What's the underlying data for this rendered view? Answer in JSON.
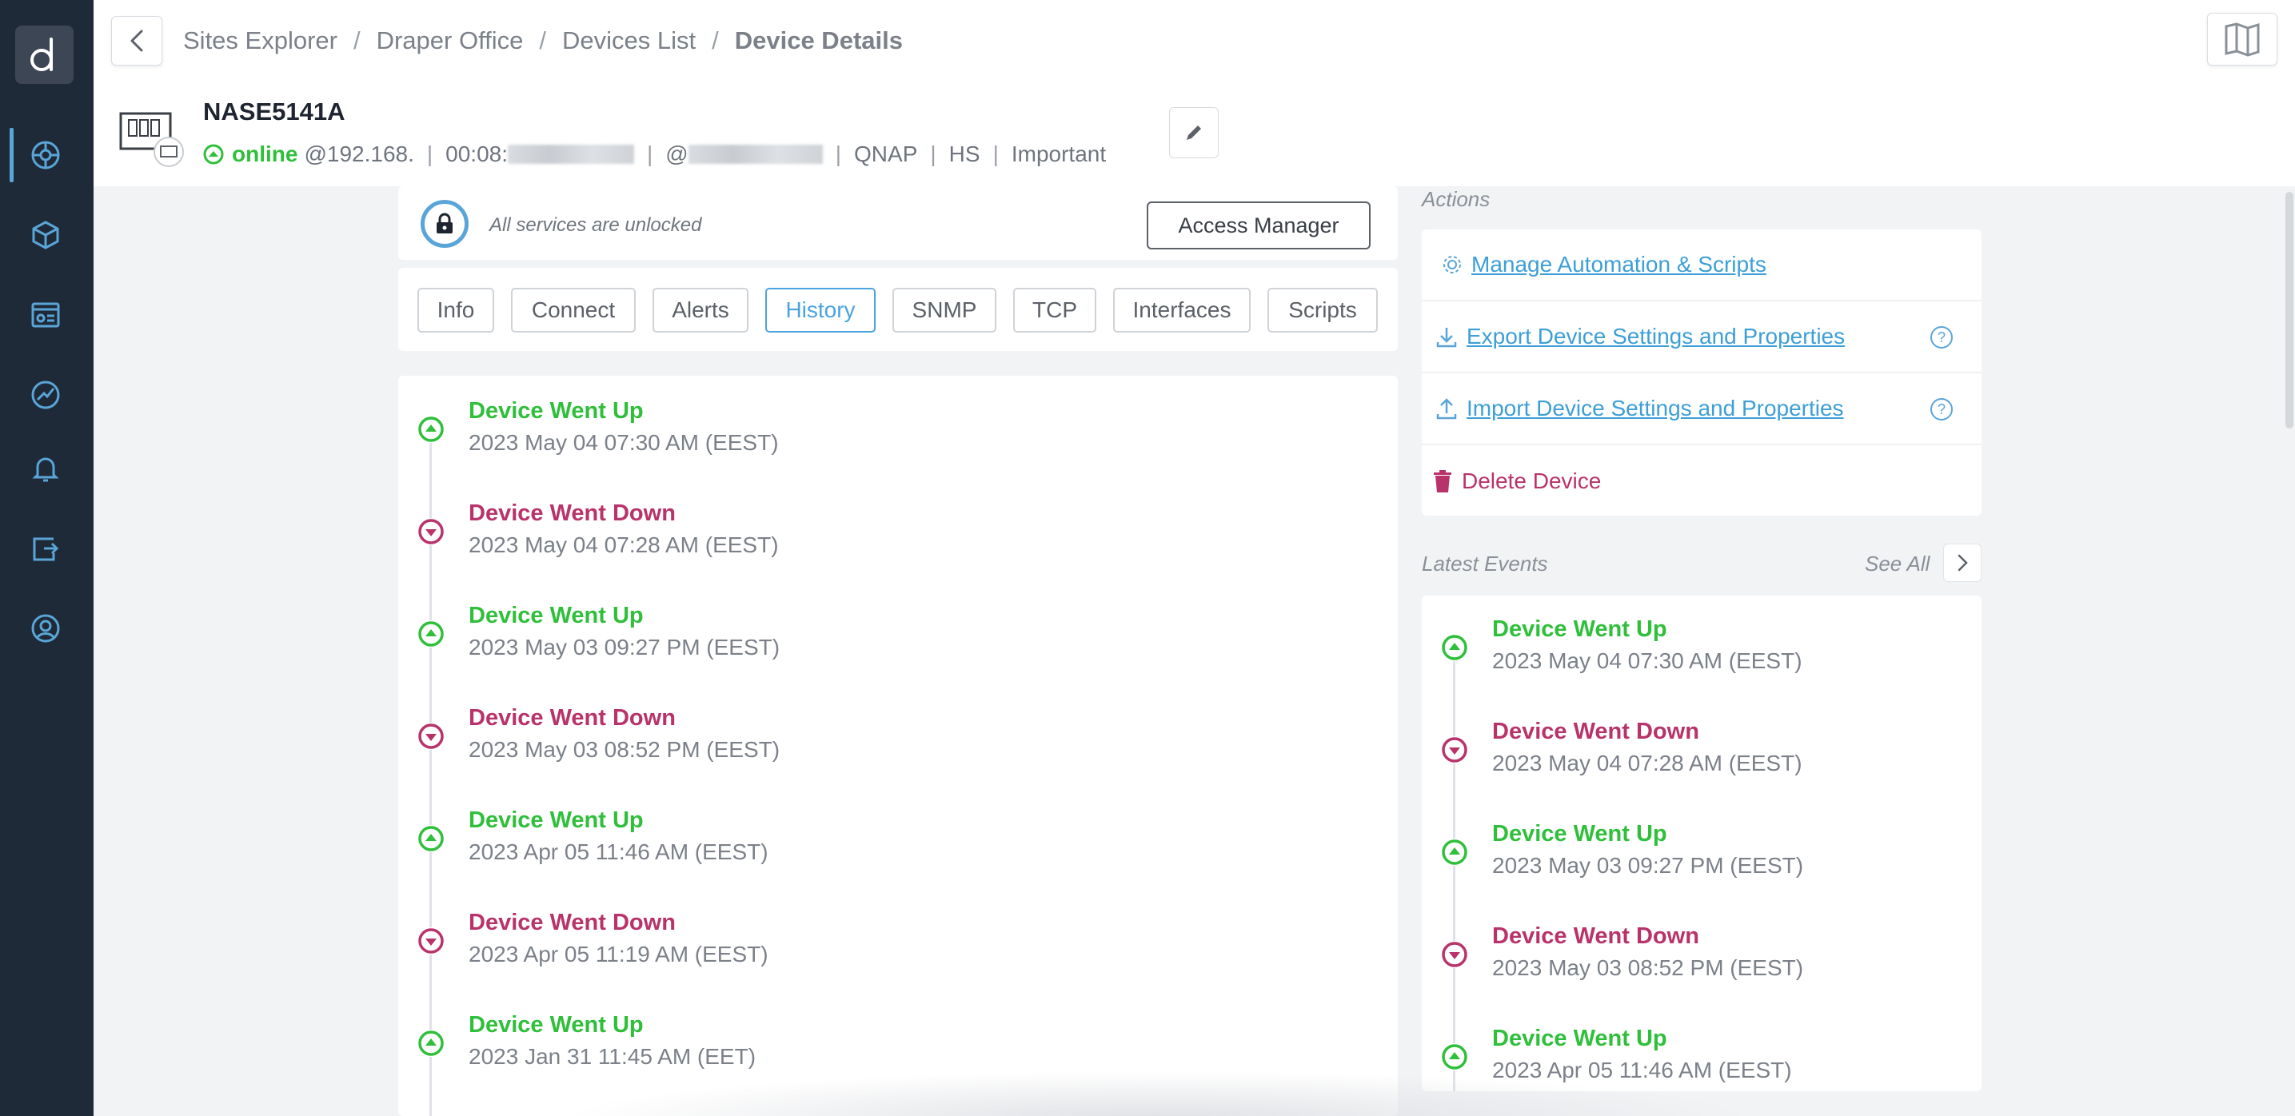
{
  "breadcrumb": {
    "items": [
      "Sites Explorer",
      "Draper Office",
      "Devices List"
    ],
    "current": "Device Details",
    "separator": "/"
  },
  "device": {
    "name": "NASE5141A",
    "status": "online",
    "ip_prefix": "@192.168.",
    "mac_prefix": "00:08:",
    "host_prefix": "@",
    "vendor": "QNAP",
    "site_code": "HS",
    "priority": "Important"
  },
  "lock": {
    "text": "All services are unlocked",
    "button_label": "Access Manager"
  },
  "tabs": [
    {
      "label": "Info",
      "active": false
    },
    {
      "label": "Connect",
      "active": false
    },
    {
      "label": "Alerts",
      "active": false
    },
    {
      "label": "History",
      "active": true
    },
    {
      "label": "SNMP",
      "active": false
    },
    {
      "label": "TCP",
      "active": false
    },
    {
      "label": "Interfaces",
      "active": false
    },
    {
      "label": "Scripts",
      "active": false
    }
  ],
  "history": [
    {
      "title": "Device Went Up",
      "time": "2023 May 04 07:30 AM (EEST)",
      "kind": "up"
    },
    {
      "title": "Device Went Down",
      "time": "2023 May 04 07:28 AM (EEST)",
      "kind": "down"
    },
    {
      "title": "Device Went Up",
      "time": "2023 May 03 09:27 PM (EEST)",
      "kind": "up"
    },
    {
      "title": "Device Went Down",
      "time": "2023 May 03 08:52 PM (EEST)",
      "kind": "down"
    },
    {
      "title": "Device Went Up",
      "time": "2023 Apr 05 11:46 AM (EEST)",
      "kind": "up"
    },
    {
      "title": "Device Went Down",
      "time": "2023 Apr 05 11:19 AM (EEST)",
      "kind": "down"
    },
    {
      "title": "Device Went Up",
      "time": "2023 Jan 31 11:45 AM (EET)",
      "kind": "up"
    }
  ],
  "actions": {
    "label": "Actions",
    "manage_automation": "Manage Automation & Scripts",
    "export_settings": "Export Device Settings and Properties",
    "import_settings": "Import Device Settings and Properties",
    "delete_device": "Delete Device",
    "help_glyph": "?"
  },
  "latest_events": {
    "label": "Latest Events",
    "see_all": "See All",
    "items": [
      {
        "title": "Device Went Up",
        "time": "2023 May 04 07:30 AM (EEST)",
        "kind": "up"
      },
      {
        "title": "Device Went Down",
        "time": "2023 May 04 07:28 AM (EEST)",
        "kind": "down"
      },
      {
        "title": "Device Went Up",
        "time": "2023 May 03 09:27 PM (EEST)",
        "kind": "up"
      },
      {
        "title": "Device Went Down",
        "time": "2023 May 03 08:52 PM (EEST)",
        "kind": "down"
      },
      {
        "title": "Device Went Up",
        "time": "2023 Apr 05 11:46 AM (EEST)",
        "kind": "up"
      }
    ]
  },
  "sidebar": {
    "icons": [
      "network-icon",
      "cube-icon",
      "dashboard-icon",
      "monitor-icon",
      "bell-icon",
      "integrations-icon",
      "support-icon"
    ],
    "active_index": 0
  },
  "colors": {
    "sidebar_bg": "#1f2a38",
    "accent": "#4aa3df",
    "up": "#2fbf3a",
    "down": "#b8336a"
  }
}
